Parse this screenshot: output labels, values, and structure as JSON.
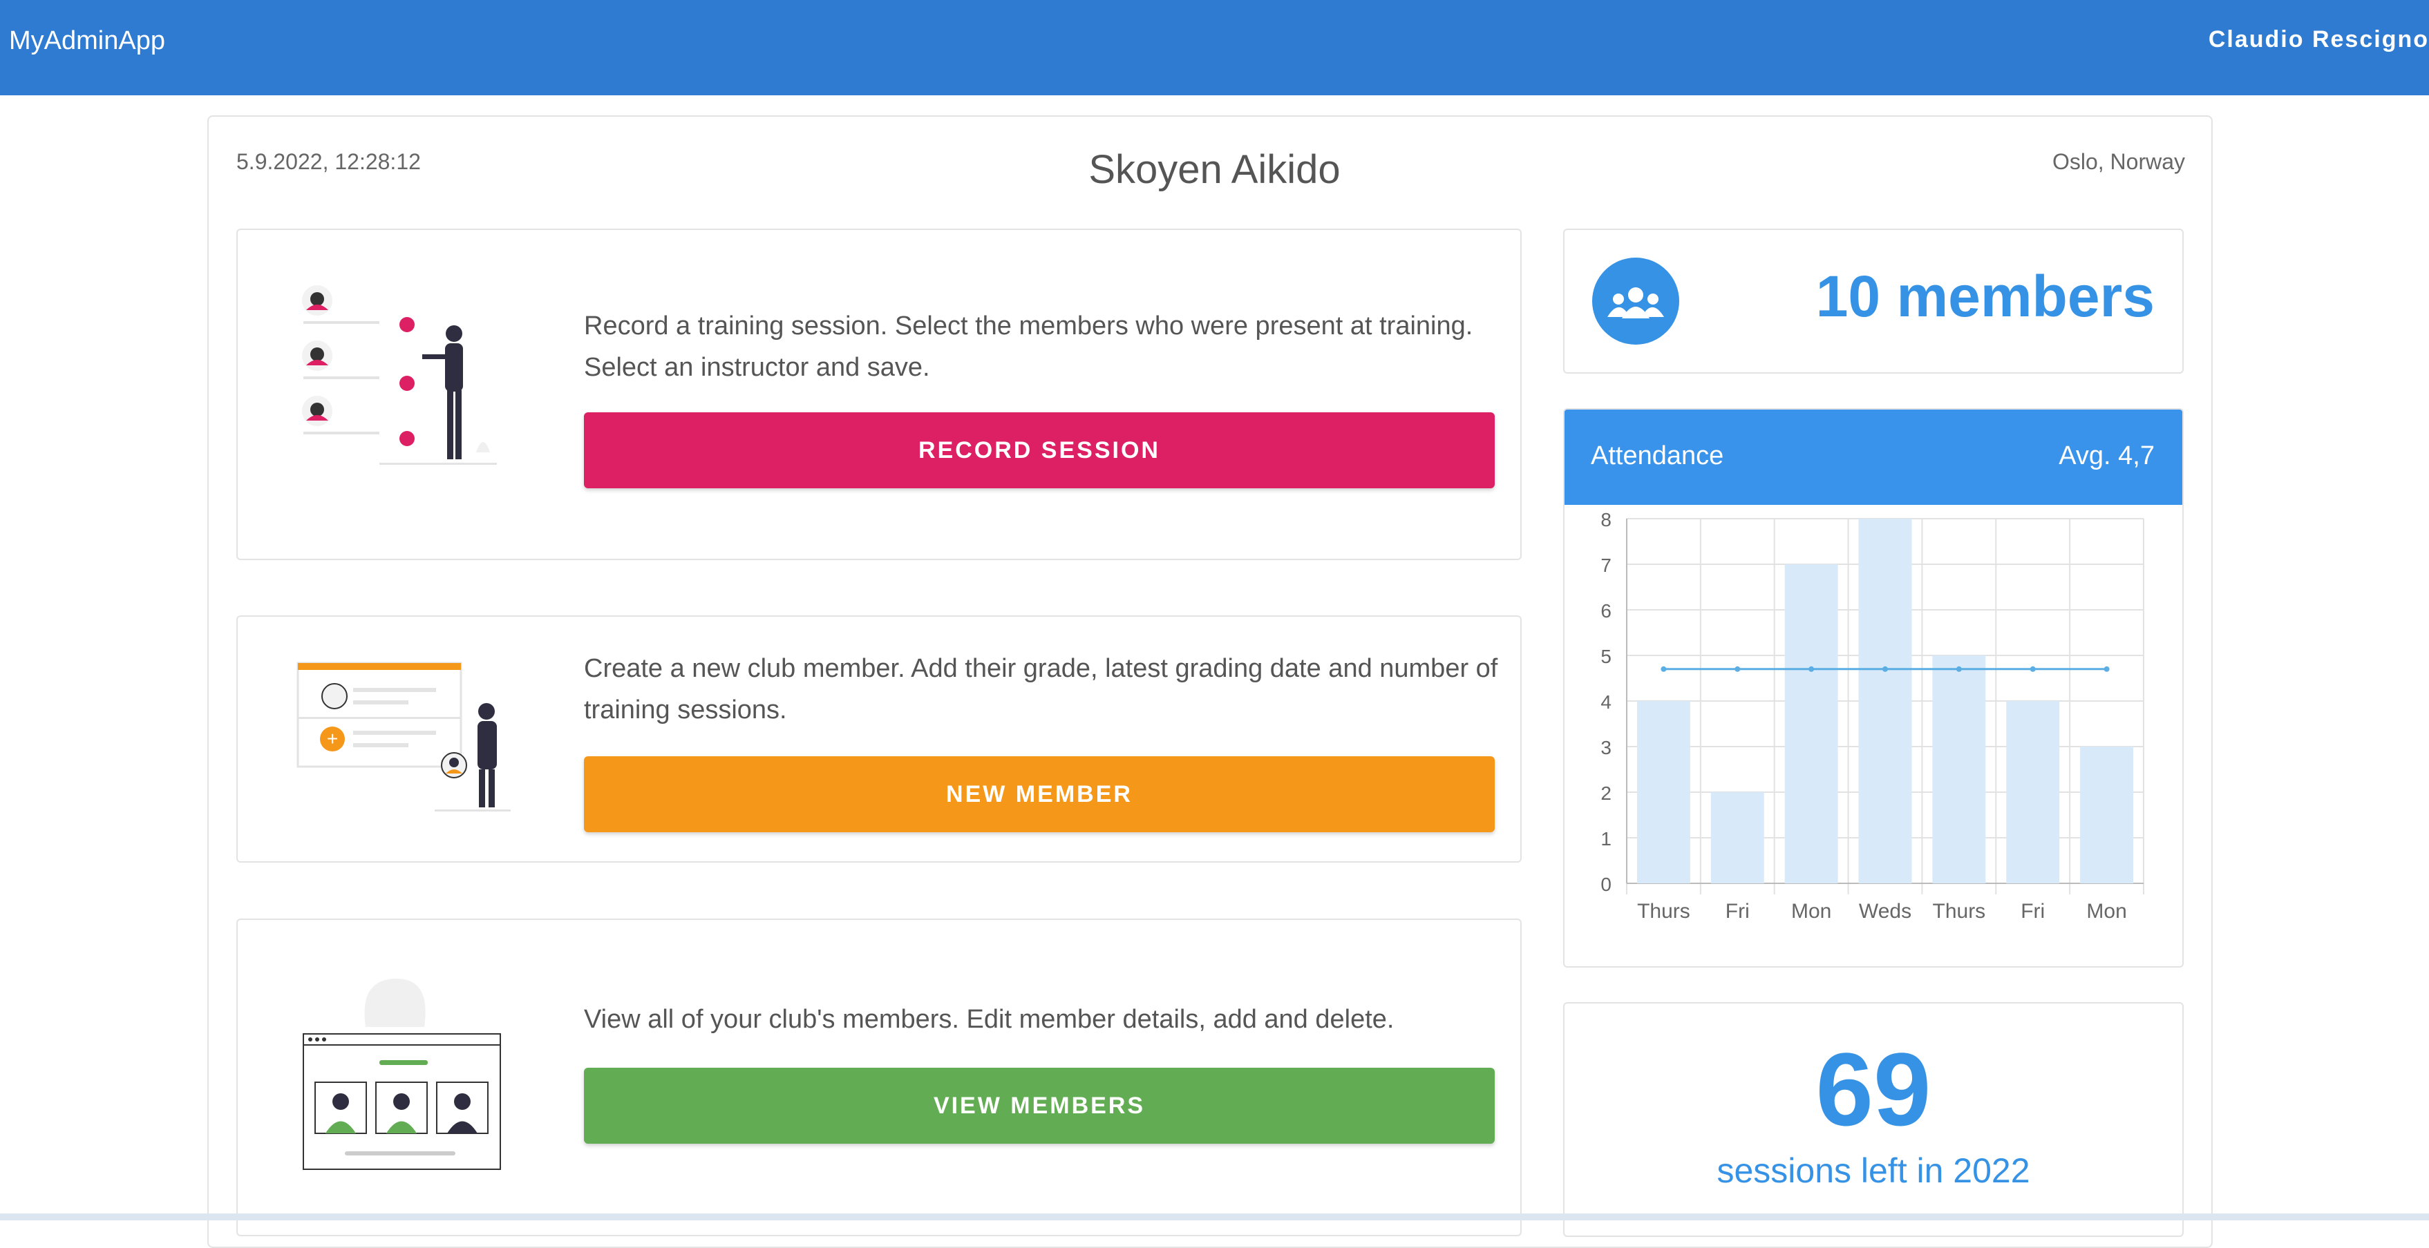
{
  "app": {
    "title": "MyAdminApp",
    "user": "Claudio Rescigno"
  },
  "club": {
    "datetime": "5.9.2022, 12:28:12",
    "name": "Skoyen Aikido",
    "location": "Oslo, Norway"
  },
  "actions": [
    {
      "text": "Record a training session. Select the members who were present at training. Select an instructor and save.",
      "button": "RECORD SESSION",
      "color": "#dd1f63"
    },
    {
      "text": "Create a new club member. Add their grade, latest grading date and number of training sessions.",
      "button": "NEW MEMBER",
      "color": "#f59819"
    },
    {
      "text": "View all of your club's members. Edit member details, add and delete.",
      "button": "VIEW MEMBERS",
      "color": "#62ad53"
    }
  ],
  "members": {
    "count_label": "10 members",
    "icon": "group-icon"
  },
  "attendance": {
    "title": "Attendance",
    "average": "Avg. 4,7"
  },
  "sessions": {
    "number": "69",
    "label": "sessions left in 2022"
  },
  "chart_data": {
    "type": "bar",
    "categories": [
      "Thurs",
      "Fri",
      "Mon",
      "Weds",
      "Thurs",
      "Fri",
      "Mon"
    ],
    "series": [
      {
        "values": [
          4,
          2,
          7,
          8,
          5,
          4,
          3
        ]
      },
      {
        "type": "line",
        "values": [
          4.7,
          4.7,
          4.7,
          4.7,
          4.7,
          4.7,
          4.7
        ]
      }
    ],
    "ylim": [
      0,
      8
    ],
    "yticks": [
      0,
      1,
      2,
      3,
      4,
      5,
      6,
      7,
      8
    ],
    "grid": true,
    "colors": {
      "bar": "#d8e9f9",
      "line": "#5aaee3"
    }
  }
}
